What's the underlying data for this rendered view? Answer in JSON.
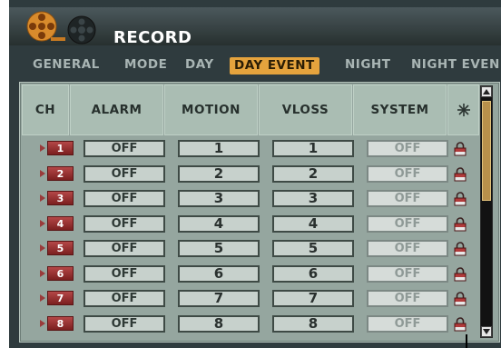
{
  "title": "RECORD",
  "tabs": [
    {
      "label": "GENERAL",
      "active": false
    },
    {
      "label": "MODE",
      "active": false
    },
    {
      "label": "DAY",
      "active": false
    },
    {
      "label": "DAY EVENT",
      "active": true
    },
    {
      "label": "NIGHT",
      "active": false
    },
    {
      "label": "NIGHT EVEN",
      "active": false
    }
  ],
  "columns": {
    "ch": "CH",
    "alarm": "ALARM",
    "motion": "MOTION",
    "vloss": "VLOSS",
    "system": "SYSTEM"
  },
  "rows": [
    {
      "ch": "1",
      "alarm": "OFF",
      "motion": "1",
      "vloss": "1",
      "system": "OFF"
    },
    {
      "ch": "2",
      "alarm": "OFF",
      "motion": "2",
      "vloss": "2",
      "system": "OFF"
    },
    {
      "ch": "3",
      "alarm": "OFF",
      "motion": "3",
      "vloss": "3",
      "system": "OFF"
    },
    {
      "ch": "4",
      "alarm": "OFF",
      "motion": "4",
      "vloss": "4",
      "system": "OFF"
    },
    {
      "ch": "5",
      "alarm": "OFF",
      "motion": "5",
      "vloss": "5",
      "system": "OFF"
    },
    {
      "ch": "6",
      "alarm": "OFF",
      "motion": "6",
      "vloss": "6",
      "system": "OFF"
    },
    {
      "ch": "7",
      "alarm": "OFF",
      "motion": "7",
      "vloss": "7",
      "system": "OFF"
    },
    {
      "ch": "8",
      "alarm": "OFF",
      "motion": "8",
      "vloss": "8",
      "system": "OFF"
    }
  ],
  "icons": {
    "title": "film-reel-icon",
    "header": "asterisk-icon",
    "row": "lock-icon"
  },
  "colors": {
    "accent": "#e5a33d",
    "channel_badge": "#9a3b3b",
    "panel": "#95a69f"
  }
}
